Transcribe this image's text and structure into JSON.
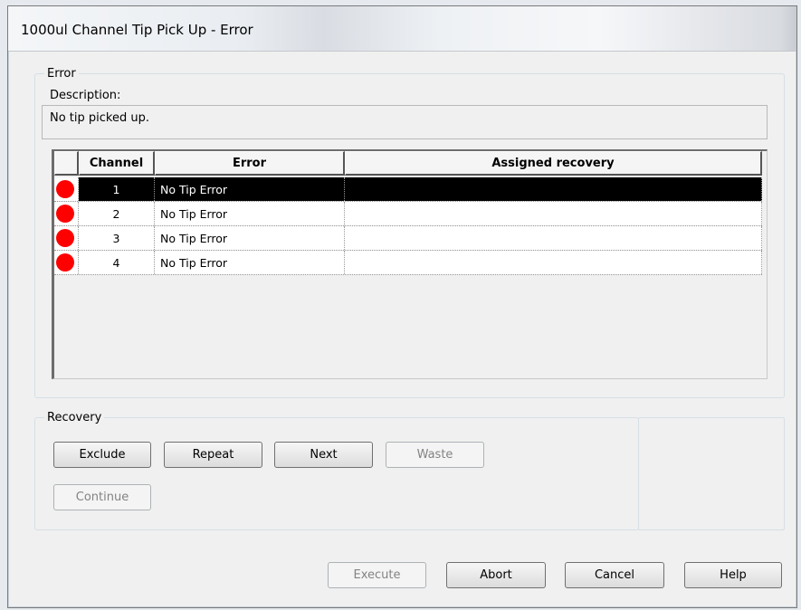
{
  "window": {
    "title": "1000ul Channel Tip Pick Up - Error"
  },
  "error_group": {
    "legend": "Error",
    "description_label": "Description:",
    "description_value": "No tip picked up."
  },
  "grid": {
    "columns": [
      "Channel",
      "Error",
      "Assigned recovery"
    ],
    "rows": [
      {
        "channel": "1",
        "error": "No Tip Error",
        "recovery": "",
        "selected": true
      },
      {
        "channel": "2",
        "error": "No Tip Error",
        "recovery": "",
        "selected": false
      },
      {
        "channel": "3",
        "error": "No Tip Error",
        "recovery": "",
        "selected": false
      },
      {
        "channel": "4",
        "error": "No Tip Error",
        "recovery": "",
        "selected": false
      }
    ],
    "indicator_color": "#ff0000"
  },
  "recovery_group": {
    "legend": "Recovery",
    "buttons": {
      "exclude": "Exclude",
      "repeat": "Repeat",
      "next": "Next",
      "waste": "Waste",
      "continue": "Continue"
    }
  },
  "footer": {
    "execute": "Execute",
    "abort": "Abort",
    "cancel": "Cancel",
    "help": "Help"
  }
}
